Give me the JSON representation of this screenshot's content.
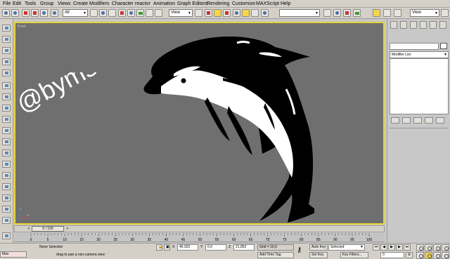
{
  "menu": [
    "File",
    "Edit",
    "Tools",
    "Group",
    "Views",
    "Create",
    "Modifiers",
    "Character",
    "reactor",
    "Animation",
    "Graph Editors",
    "Rendering",
    "Customize",
    "MAXScript",
    "Help"
  ],
  "toolbar": {
    "selection_filter": "All",
    "ref_coord": "View",
    "named_selection": "",
    "view_dropdown": "View"
  },
  "viewport": {
    "label": "Front",
    "watermark": "@byms",
    "axis_x": "X",
    "axis_y": "Z"
  },
  "command_panel": {
    "object_name": "",
    "modifier_list": "Modifier List"
  },
  "time_slider": {
    "value": "0 / 100",
    "prev": "<",
    "next": ">"
  },
  "trackbar": {
    "ticks": [
      "0",
      "5",
      "10",
      "15",
      "20",
      "25",
      "30",
      "35",
      "40",
      "45",
      "50",
      "55",
      "60",
      "65",
      "70",
      "75",
      "80",
      "85",
      "90",
      "95",
      "100"
    ]
  },
  "status": {
    "selection": "None Selected",
    "prompt": "drag to pan a non-camera view",
    "script_listener": "Max",
    "x_label": "X",
    "x_value": "46.922",
    "y_label": "Y",
    "y_value": "0,0",
    "z_label": "Z",
    "z_value": "21,852",
    "grid": "Grid = 10,0",
    "add_time_tag": "Add Time Tag",
    "auto_key": "Auto Key",
    "set_key": "Set Key",
    "key_mode": "Selected",
    "key_filters": "Key Filters...",
    "frame": "0"
  },
  "colors": {
    "viewport_bg": "#6f6f6f",
    "active_border": "#e8d236",
    "ui_gray": "#d4d0c8"
  }
}
